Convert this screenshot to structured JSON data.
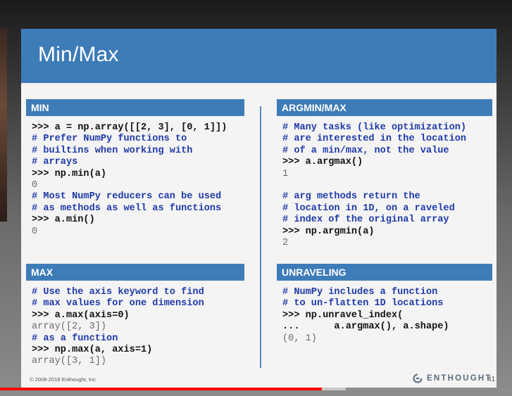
{
  "slide": {
    "title": "Min/Max",
    "copyright": "© 2008-2018 Enthought, Inc.",
    "logo_text": "ENTHOUGHT",
    "page_number": "41"
  },
  "panels": {
    "min": {
      "header": "MIN",
      "lines": [
        {
          "kind": "cmd",
          "text": ">>> a = np.array([[2, 3], [0, 1]])"
        },
        {
          "kind": "cmt",
          "text": "# Prefer NumPy functions to"
        },
        {
          "kind": "cmt",
          "text": "# builtins when working with"
        },
        {
          "kind": "cmt",
          "text": "# arrays"
        },
        {
          "kind": "cmd",
          "text": ">>> np.min(a)"
        },
        {
          "kind": "out",
          "text": "0"
        },
        {
          "kind": "cmt",
          "text": "# Most NumPy reducers can be used"
        },
        {
          "kind": "cmt",
          "text": "# as methods as well as functions"
        },
        {
          "kind": "cmd",
          "text": ">>> a.min()"
        },
        {
          "kind": "out",
          "text": "0"
        }
      ]
    },
    "argminmax": {
      "header": "ARGMIN/MAX",
      "lines": [
        {
          "kind": "cmt",
          "text": "# Many tasks (like optimization)"
        },
        {
          "kind": "cmt",
          "text": "# are interested in the location"
        },
        {
          "kind": "cmt",
          "text": "# of a min/max, not the value"
        },
        {
          "kind": "cmd",
          "text": ">>> a.argmax()"
        },
        {
          "kind": "out",
          "text": "1"
        },
        {
          "kind": "blank",
          "text": ""
        },
        {
          "kind": "cmt",
          "text": "# arg methods return the"
        },
        {
          "kind": "cmt",
          "text": "# location in 1D, on a raveled"
        },
        {
          "kind": "cmt",
          "text": "# index of the original array"
        },
        {
          "kind": "cmd",
          "text": ">>> np.argmin(a)"
        },
        {
          "kind": "out",
          "text": "2"
        }
      ]
    },
    "max": {
      "header": "MAX",
      "lines": [
        {
          "kind": "cmt",
          "text": "# Use the axis keyword to find"
        },
        {
          "kind": "cmt",
          "text": "# max values for one dimension"
        },
        {
          "kind": "cmd",
          "text": ">>> a.max(axis=0)"
        },
        {
          "kind": "out",
          "text": "array([2, 3])"
        },
        {
          "kind": "cmt",
          "text": "# as a function"
        },
        {
          "kind": "cmd",
          "text": ">>> np.max(a, axis=1)"
        },
        {
          "kind": "out",
          "text": "array([3, 1])"
        }
      ]
    },
    "unraveling": {
      "header": "UNRAVELING",
      "lines": [
        {
          "kind": "cmt",
          "text": "# NumPy includes a function"
        },
        {
          "kind": "cmt",
          "text": "# to un-flatten 1D locations"
        },
        {
          "kind": "cmd",
          "text": ">>> np.unravel_index("
        },
        {
          "kind": "cmd",
          "text": "...      a.argmax(), a.shape)"
        },
        {
          "kind": "out",
          "text": "(0, 1)"
        }
      ]
    }
  },
  "colors": {
    "banner": "#3e7cb8",
    "comment": "#1f3aa8",
    "output": "#6b6b6b",
    "progress_played": "#ff0000"
  },
  "video": {
    "played_fraction": 0.628,
    "buffered_fraction": 0.676
  }
}
